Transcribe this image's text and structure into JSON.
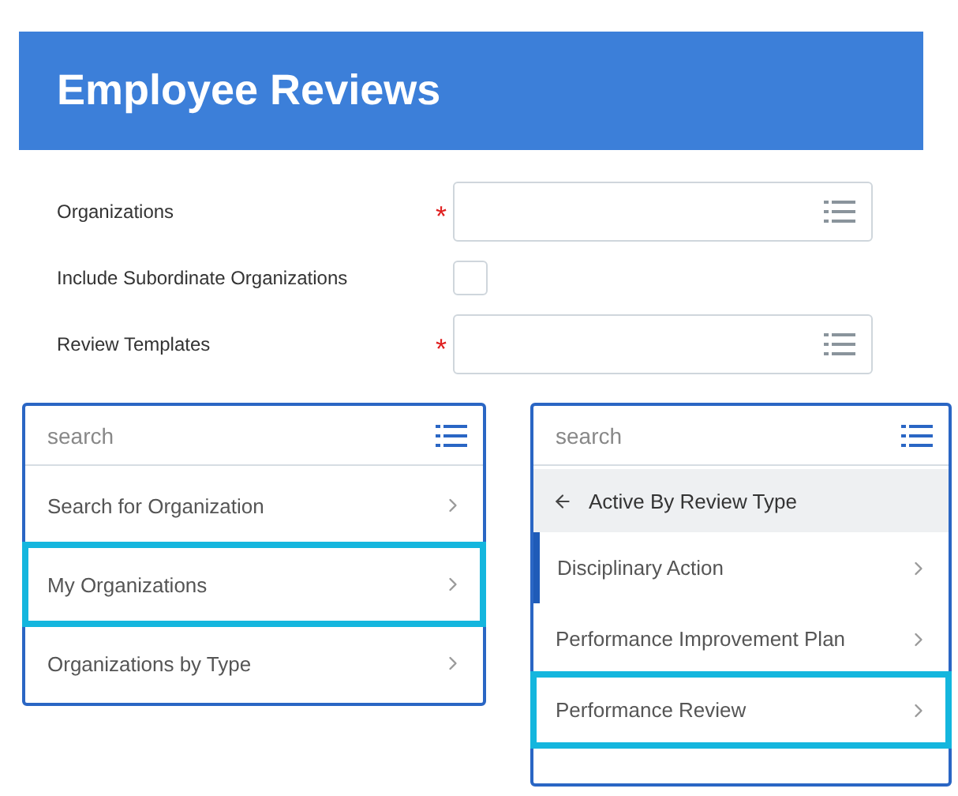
{
  "header": {
    "title": "Employee Reviews"
  },
  "form": [
    {
      "kind": "prompt",
      "label": "Organizations",
      "required_mark": "*"
    },
    {
      "kind": "checkbox",
      "label": "Include Subordinate Organizations",
      "checked": false
    },
    {
      "kind": "prompt",
      "label": "Review Templates",
      "required_mark": "*"
    }
  ],
  "panels": [
    {
      "search": {
        "placeholder": "search"
      },
      "items": [
        {
          "label": "Search for Organization",
          "highlighted": false,
          "active": false
        },
        {
          "label": "My Organizations",
          "highlighted": true,
          "active": false
        },
        {
          "label": "Organizations by Type",
          "highlighted": false,
          "active": false
        }
      ]
    },
    {
      "search": {
        "placeholder": "search"
      },
      "back": {
        "label": "Active By Review Type"
      },
      "items": [
        {
          "label": "Disciplinary Action",
          "highlighted": false,
          "active": true
        },
        {
          "label": "Performance Improvement Plan",
          "highlighted": false,
          "active": false
        },
        {
          "label": "Performance Review",
          "highlighted": true,
          "active": false
        }
      ]
    }
  ]
}
